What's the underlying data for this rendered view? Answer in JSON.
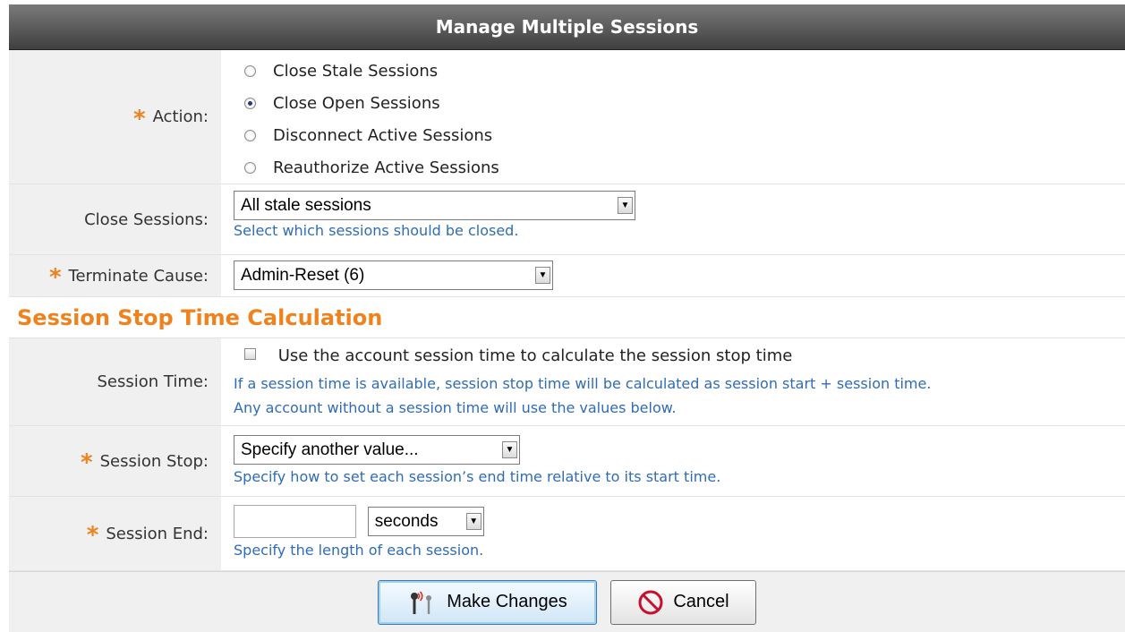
{
  "form": {
    "title": "Manage Multiple Sessions",
    "action": {
      "label": "Action:",
      "options": [
        {
          "label": "Close Stale Sessions",
          "checked": false
        },
        {
          "label": "Close Open Sessions",
          "checked": true
        },
        {
          "label": "Disconnect Active Sessions",
          "checked": false
        },
        {
          "label": "Reauthorize Active Sessions",
          "checked": false
        }
      ]
    },
    "close_sessions": {
      "label": "Close Sessions:",
      "value": "All stale sessions",
      "help": "Select which sessions should be closed."
    },
    "terminate_cause": {
      "label": "Terminate Cause:",
      "value": "Admin-Reset (6)"
    },
    "section_title": "Session Stop Time Calculation",
    "session_time": {
      "label": "Session Time:",
      "checkbox_label": "Use the account session time to calculate the session stop time",
      "checked": false,
      "help1": "If a session time is available, session stop time will be calculated as session start + session time.",
      "help2": "Any account without a session time will use the values below."
    },
    "session_stop": {
      "label": "Session Stop:",
      "value": "Specify another value...",
      "help": "Specify how to set each session’s end time relative to its start time."
    },
    "session_end": {
      "label": "Session End:",
      "value": "",
      "unit": "seconds",
      "help": "Specify the length of each session."
    },
    "buttons": {
      "submit": "Make Changes",
      "cancel": "Cancel"
    },
    "required_marker": "*"
  },
  "colors": {
    "accent": "#f0821e",
    "help_text": "#2f6cb5",
    "label_bg": "#f0f0f0"
  },
  "icons": {
    "submit": "radio-signal-icon",
    "cancel": "prohibited-icon"
  }
}
